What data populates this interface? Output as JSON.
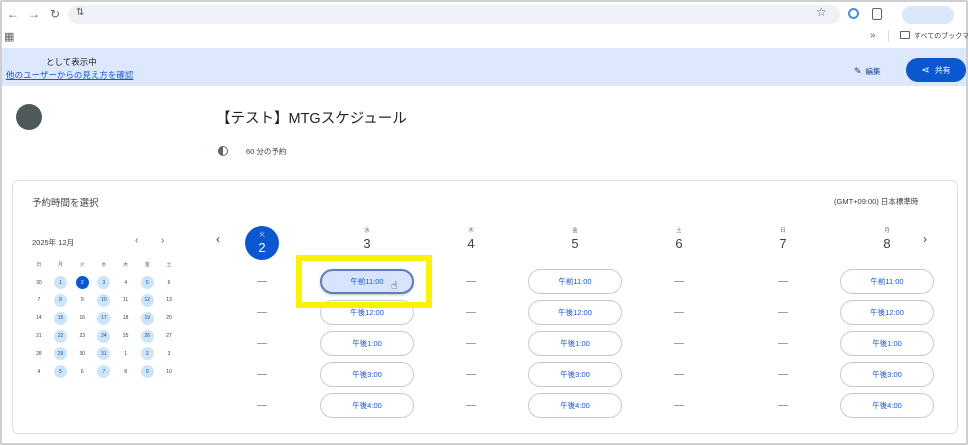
{
  "browser": {
    "nav_icons": [
      "back-arrow-icon",
      "forward-arrow-icon",
      "reload-icon"
    ],
    "back": "←",
    "forward": "→",
    "reload": "↻",
    "site_settings_icon": "⇅",
    "star": "☆",
    "bookmarks_more": "»",
    "bookmarks_folder": "すべてのブックマ"
  },
  "banner": {
    "title": "として表示中",
    "link": "他のユーザーからの見え方を確認",
    "edit": "編集",
    "share": "共有"
  },
  "page": {
    "title": "【テスト】MTGスケジュール",
    "duration": "60 分の予約"
  },
  "scheduler": {
    "heading": "予約時間を選択",
    "timezone": "(GMT+09:00) 日本標準時",
    "mini_calendar": {
      "month": "2025年 12月",
      "weekdays": [
        "日",
        "月",
        "火",
        "水",
        "木",
        "金",
        "土"
      ],
      "weeks": [
        [
          "30",
          "1",
          "2",
          "3",
          "4",
          "5",
          "6"
        ],
        [
          "7",
          "8",
          "9",
          "10",
          "11",
          "12",
          "13"
        ],
        [
          "14",
          "15",
          "16",
          "17",
          "18",
          "19",
          "20"
        ],
        [
          "21",
          "22",
          "23",
          "24",
          "25",
          "26",
          "27"
        ],
        [
          "28",
          "29",
          "30",
          "31",
          "1",
          "2",
          "3"
        ],
        [
          "4",
          "5",
          "6",
          "7",
          "8",
          "9",
          "10"
        ]
      ],
      "selected": "2"
    },
    "days": [
      {
        "dow": "火",
        "num": "2",
        "today": true,
        "slots": []
      },
      {
        "dow": "水",
        "num": "3",
        "today": false,
        "slots": [
          "午前11:00",
          "午後12:00",
          "午後1:00",
          "午後3:00",
          "午後4:00"
        ]
      },
      {
        "dow": "木",
        "num": "4",
        "today": false,
        "slots": []
      },
      {
        "dow": "金",
        "num": "5",
        "today": false,
        "slots": [
          "午前11:00",
          "午後12:00",
          "午後1:00",
          "午後3:00",
          "午後4:00"
        ]
      },
      {
        "dow": "土",
        "num": "6",
        "today": false,
        "slots": []
      },
      {
        "dow": "日",
        "num": "7",
        "today": false,
        "slots": []
      },
      {
        "dow": "月",
        "num": "8",
        "today": false,
        "slots": [
          "午前11:00",
          "午後12:00",
          "午後1:00",
          "午後3:00",
          "午後4:00"
        ]
      }
    ],
    "hovered_slot": "水 3 午前11:00"
  },
  "colors": {
    "accent": "#0b57d0",
    "banner_bg": "#dde8fc",
    "highlight": "#fbf200",
    "available_day": "#cde5f8"
  }
}
